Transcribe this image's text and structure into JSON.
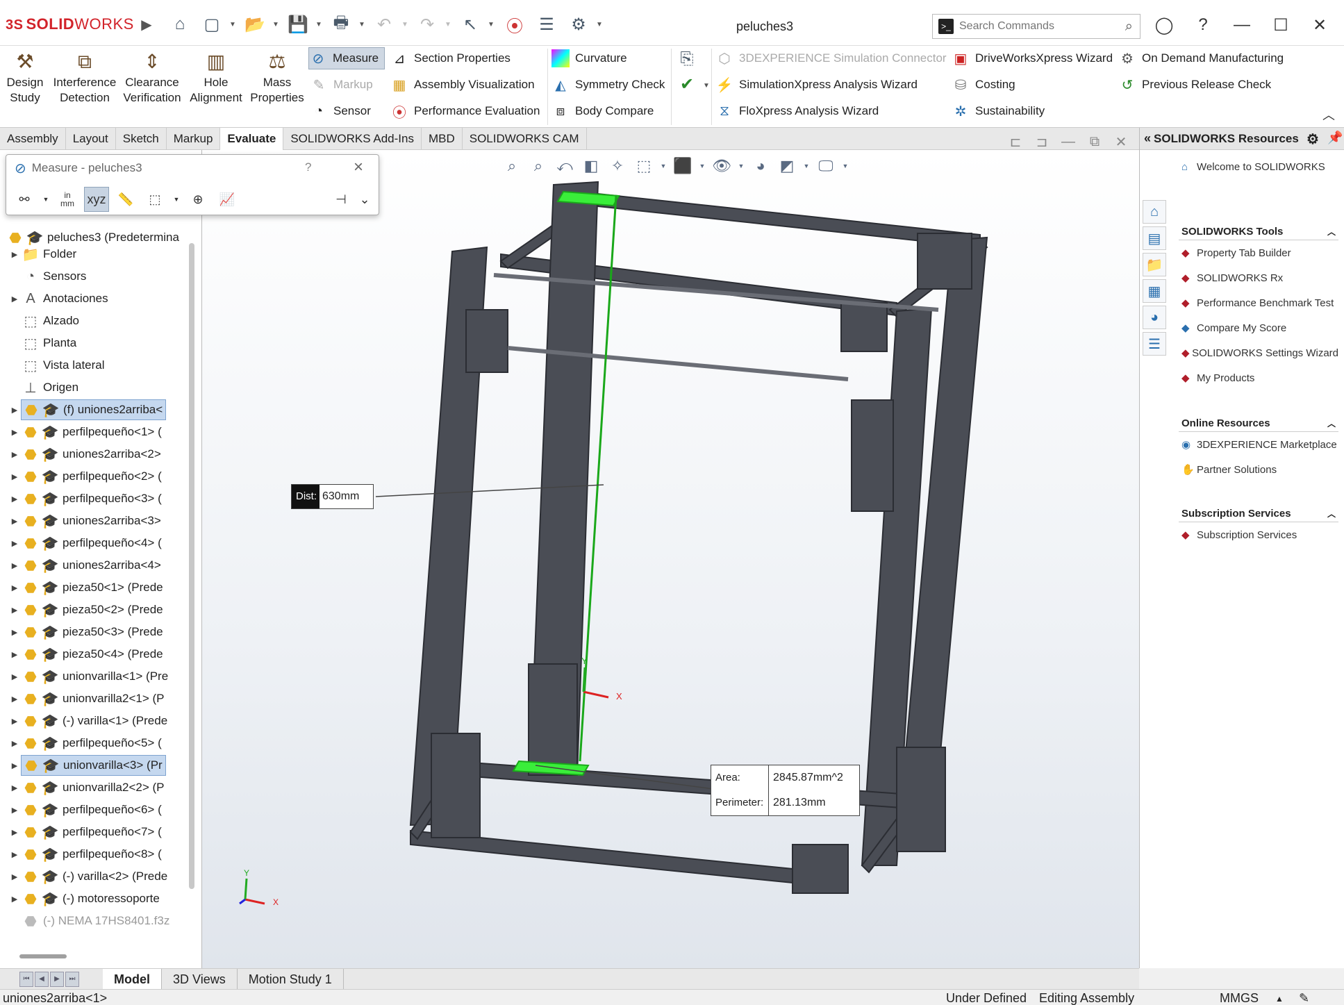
{
  "app": {
    "brand_ds": "3S",
    "brand_solid": "SOLID",
    "brand_works": "WORKS",
    "document_title": "peluches3"
  },
  "search": {
    "placeholder": "Search Commands"
  },
  "ribbon": {
    "design_study": "Design Study",
    "interference_detection": "Interference Detection",
    "clearance_verification": "Clearance Verification",
    "hole_alignment": "Hole Alignment",
    "mass_properties": "Mass Properties",
    "measure": "Measure",
    "markup": "Markup",
    "sensor": "Sensor",
    "section_properties": "Section Properties",
    "assembly_visualization": "Assembly Visualization",
    "performance_evaluation": "Performance Evaluation",
    "curvature": "Curvature",
    "symmetry_check": "Symmetry Check",
    "body_compare": "Body Compare",
    "simulation_connector": "3DEXPERIENCE Simulation Connector",
    "simulationxpress": "SimulationXpress Analysis Wizard",
    "floxpress": "FloXpress Analysis Wizard",
    "driveworksxpress": "DriveWorksXpress Wizard",
    "costing": "Costing",
    "sustainability": "Sustainability",
    "on_demand": "On Demand Manufacturing",
    "previous_release": "Previous Release Check"
  },
  "tabs": [
    "Assembly",
    "Layout",
    "Sketch",
    "Markup",
    "Evaluate",
    "SOLIDWORKS Add-Ins",
    "MBD",
    "SOLIDWORKS CAM"
  ],
  "measure_dialog": {
    "title": "Measure - peluches3",
    "help": "?",
    "units_top": "in",
    "units_bottom": "mm"
  },
  "tree": {
    "root": "peluches3 (Predetermina",
    "items": [
      {
        "label": "Folder"
      },
      {
        "label": "Sensors"
      },
      {
        "label": "Anotaciones"
      },
      {
        "label": "Alzado"
      },
      {
        "label": "Planta"
      },
      {
        "label": "Vista lateral"
      },
      {
        "label": "Origen"
      },
      {
        "label": "(f) uniones2arriba<"
      },
      {
        "label": "perfilpequeño<1> ("
      },
      {
        "label": "uniones2arriba<2> "
      },
      {
        "label": "perfilpequeño<2> ("
      },
      {
        "label": "perfilpequeño<3> ("
      },
      {
        "label": "uniones2arriba<3> "
      },
      {
        "label": "perfilpequeño<4> ("
      },
      {
        "label": "uniones2arriba<4> "
      },
      {
        "label": "pieza50<1> (Prede"
      },
      {
        "label": "pieza50<2> (Prede"
      },
      {
        "label": "pieza50<3> (Prede"
      },
      {
        "label": "pieza50<4> (Prede"
      },
      {
        "label": "unionvarilla<1> (Pre"
      },
      {
        "label": "unionvarilla2<1> (P"
      },
      {
        "label": "(-) varilla<1> (Prede"
      },
      {
        "label": "perfilpequeño<5> ("
      },
      {
        "label": "unionvarilla<3> (Pr"
      },
      {
        "label": "unionvarilla2<2> (P"
      },
      {
        "label": "perfilpequeño<6> ("
      },
      {
        "label": "perfilpequeño<7> ("
      },
      {
        "label": "perfilpequeño<8> ("
      },
      {
        "label": "(-) varilla<2> (Prede"
      },
      {
        "label": "(-) motoressoporte"
      },
      {
        "label": "(-) NEMA 17HS8401.f3z"
      }
    ]
  },
  "measurement": {
    "dist_label": "Dist:",
    "dist_value": "630mm",
    "area_label": "Area:",
    "area_value": "2845.87mm^2",
    "perimeter_label": "Perimeter:",
    "perimeter_value": "281.13mm"
  },
  "triad": {
    "x": "X",
    "y": "Y"
  },
  "resources": {
    "header": "SOLIDWORKS Resources",
    "welcome": "Welcome to SOLIDWORKS",
    "tools_title": "SOLIDWORKS Tools",
    "tools": [
      "Property Tab Builder",
      "SOLIDWORKS Rx",
      "Performance Benchmark Test",
      "Compare My Score",
      "SOLIDWORKS Settings Wizard",
      "My Products"
    ],
    "online_title": "Online Resources",
    "online": [
      "3DEXPERIENCE Marketplace",
      "Partner Solutions"
    ],
    "subs_title": "Subscription Services",
    "subs": [
      "Subscription Services"
    ]
  },
  "bottom_tabs": [
    "Model",
    "3D Views",
    "Motion Study 1"
  ],
  "status": {
    "left": "uniones2arriba<1>",
    "defined": "Under Defined",
    "mode": "Editing Assembly",
    "units": "MMGS"
  }
}
